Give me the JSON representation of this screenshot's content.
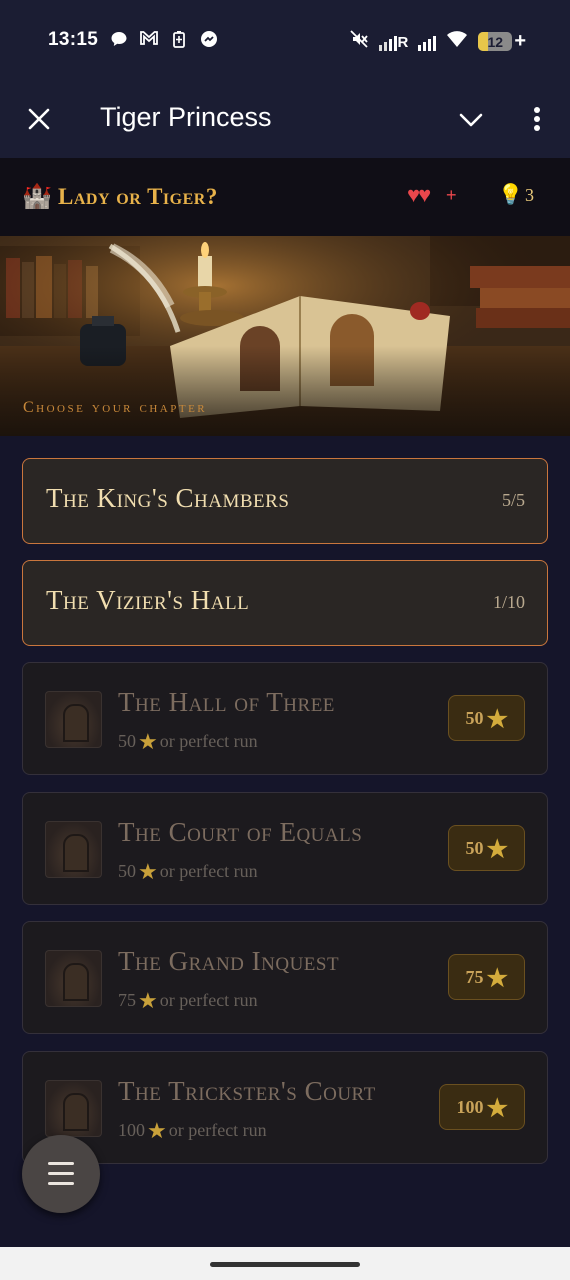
{
  "status_bar": {
    "time": "13:15",
    "battery_level": "12",
    "icons_left": [
      "chat-bubble-icon",
      "gmail-icon",
      "battery-saver-icon",
      "messenger-icon"
    ],
    "icons_right": [
      "mute-icon",
      "signal-roaming-icon",
      "signal-icon",
      "wifi-icon",
      "battery-icon"
    ],
    "roaming_label": "R"
  },
  "app_bar": {
    "title": "Tiger Princess"
  },
  "game_header": {
    "title": "Lady or Tiger?",
    "hearts": "♥♥",
    "hearts_plus": "+",
    "hints": "3"
  },
  "banner": {
    "caption": "Choose your chapter"
  },
  "chapters": [
    {
      "name": "The King's Chambers",
      "progress": "5/5",
      "locked": false
    },
    {
      "name": "The Vizier's Hall",
      "progress": "1/10",
      "locked": false
    },
    {
      "name": "The Hall of Three",
      "requirement_stars": "50",
      "requirement_suffix": "or perfect run",
      "cost": "50",
      "locked": true
    },
    {
      "name": "The Court of Equals",
      "requirement_stars": "50",
      "requirement_suffix": "or perfect run",
      "cost": "50",
      "locked": true
    },
    {
      "name": "The Grand Inquest",
      "requirement_stars": "75",
      "requirement_suffix": "or perfect run",
      "cost": "75",
      "locked": true
    },
    {
      "name": "The Trickster's Court",
      "requirement_stars": "100",
      "requirement_suffix": "or perfect run",
      "cost": "100",
      "locked": true
    }
  ],
  "colors": {
    "accent_gold": "#e8b24a",
    "heart_red": "#e9474c",
    "open_border": "#c9763d",
    "star": "#d4ac3c"
  }
}
